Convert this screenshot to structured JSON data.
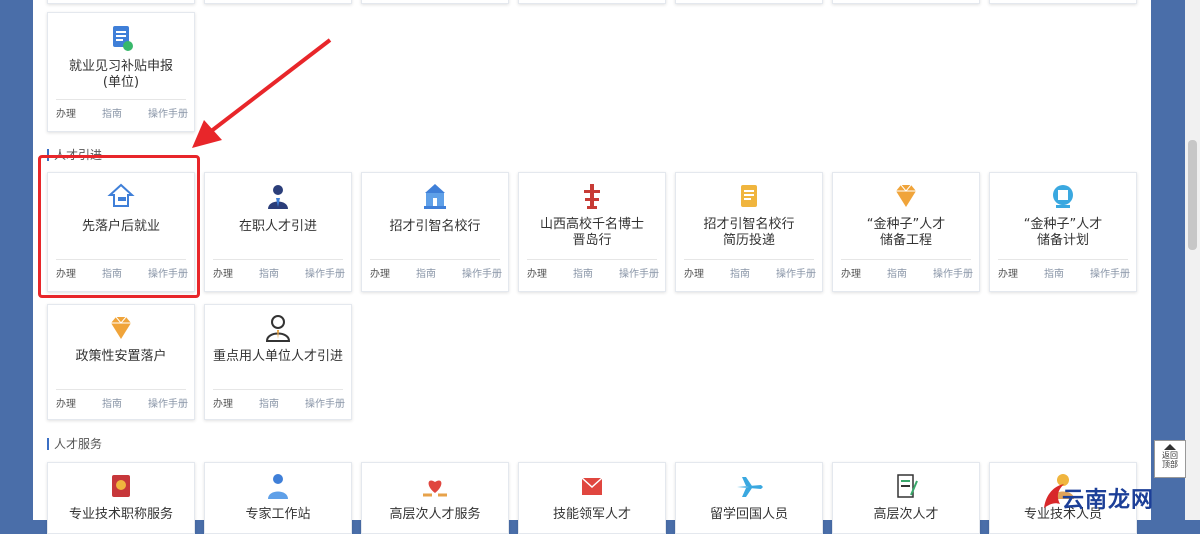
{
  "actions": [
    "办理",
    "指南",
    "操作手册"
  ],
  "first_card": {
    "name_line1": "就业见习补贴申报",
    "name_line2": "(单位)"
  },
  "section_talent_intro": {
    "title": "人才引进"
  },
  "talent_cards_row1": [
    {
      "line1": "先落户后就业",
      "line2": "",
      "icon": "house-graduation-icon"
    },
    {
      "line1": "在职人才引进",
      "line2": "",
      "icon": "businessman-icon"
    },
    {
      "line1": "招才引智名校行",
      "line2": "",
      "icon": "university-building-icon"
    },
    {
      "line1": "山西高校千名博士",
      "line2": "晋岛行",
      "icon": "tower-icon"
    },
    {
      "line1": "招才引智名校行",
      "line2": "简历投递",
      "icon": "document-icon"
    },
    {
      "line1": "“金种子”人才",
      "line2": "储备工程",
      "icon": "diamond-icon"
    },
    {
      "line1": "“金种子”人才",
      "line2": "储备计划",
      "icon": "badge-icon"
    }
  ],
  "talent_cards_row2": [
    {
      "line1": "政策性安置落户",
      "icon": "diamond-icon"
    },
    {
      "line1": "重点用人单位人才引进",
      "icon": "person-tie-icon"
    }
  ],
  "section_talent_service": {
    "title": "人才服务"
  },
  "service_cards": [
    {
      "line1": "专业技术职称服务",
      "icon": "certificate-book-icon"
    },
    {
      "line1": "专家工作站",
      "icon": "expert-icon"
    },
    {
      "line1": "高层次人才服务",
      "icon": "heart-hands-icon"
    },
    {
      "line1": "技能领军人才",
      "icon": "envelope-icon"
    },
    {
      "line1": "留学回国人员",
      "icon": "airplane-icon"
    },
    {
      "line1": "高层次人才",
      "icon": "form-pen-icon"
    },
    {
      "line1": "专业技术人员",
      "icon": "person-icon"
    }
  ],
  "back_to_top": {
    "line1": "返回",
    "line2": "顶部"
  },
  "watermark": {
    "text": "云南龙网"
  },
  "colors": {
    "highlight": "#e8262a",
    "accent_blue": "#3b6fc4",
    "side_bg": "#4a6ea9"
  }
}
